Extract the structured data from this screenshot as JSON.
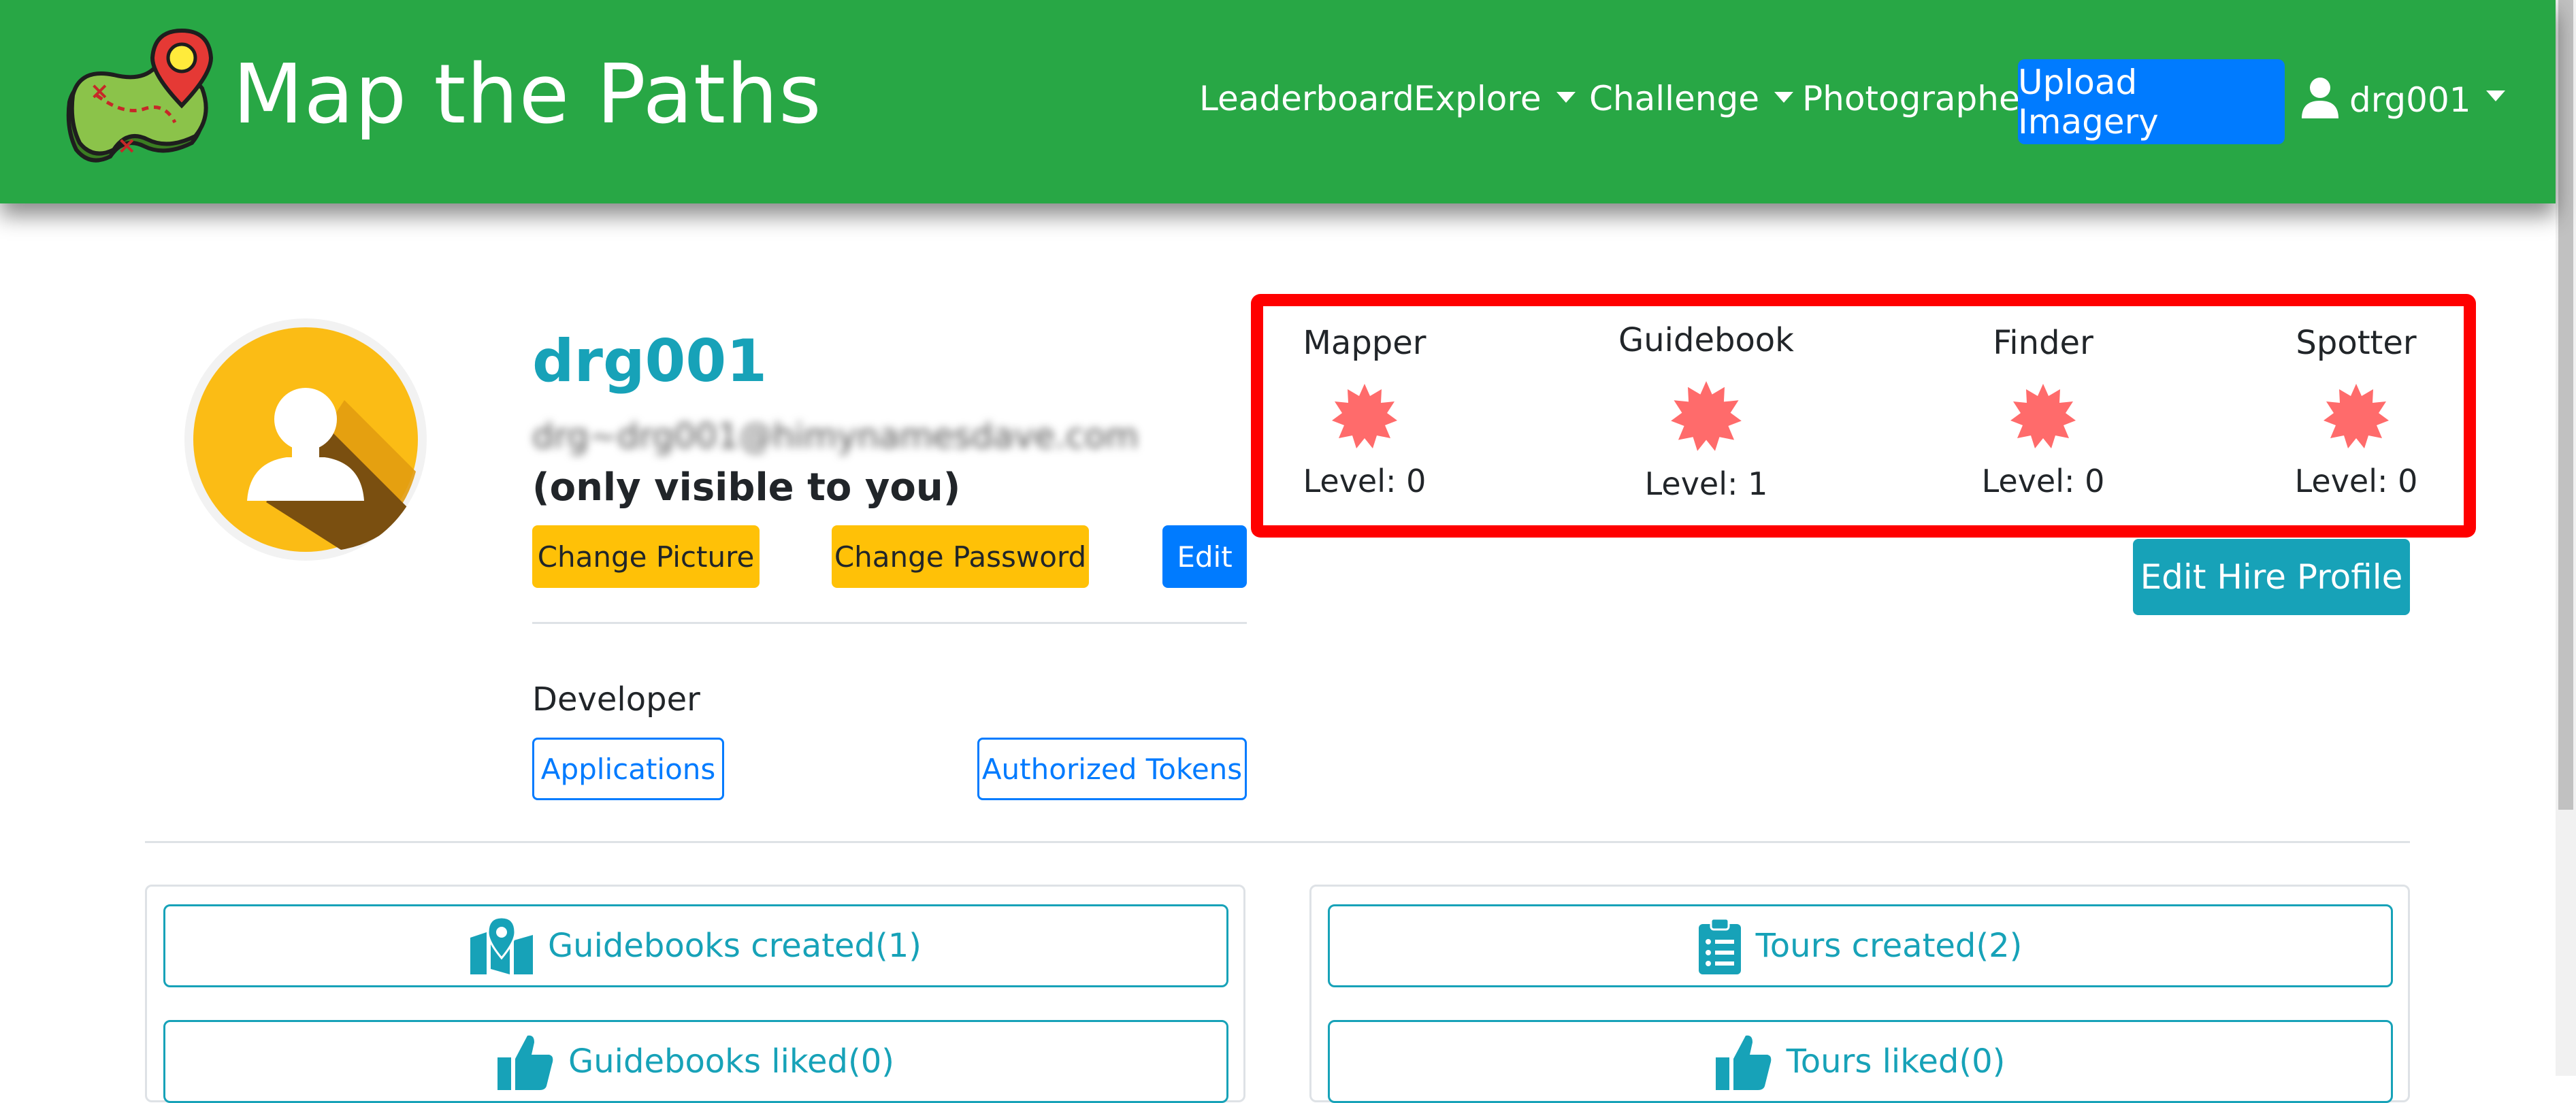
{
  "navbar": {
    "brand": "Map the Paths",
    "links": {
      "leaderboard": "Leaderboard",
      "explore": "Explore",
      "challenge": "Challenge",
      "photographer": "Photographer"
    },
    "upload_label": "Upload Imagery",
    "user_label": "drg001",
    "bg_color": "#28a745"
  },
  "profile": {
    "username": "drg001",
    "email_blurred": "drg~drg001@himynamesdave.com",
    "visibility_note": "(only visible to you)",
    "buttons": {
      "change_picture": "Change Picture",
      "change_password": "Change Password",
      "edit": "Edit"
    },
    "developer_heading": "Developer",
    "developer_buttons": {
      "applications": "Applications",
      "authorized_tokens": "Authorized Tokens"
    }
  },
  "badges": [
    {
      "title": "Mapper",
      "level": "Level: 0"
    },
    {
      "title": "Guidebook",
      "level": "Level: 1"
    },
    {
      "title": "Finder",
      "level": "Level: 0"
    },
    {
      "title": "Spotter",
      "level": "Level: 0"
    }
  ],
  "hire_profile_label": "Edit Hire Profile",
  "cards": {
    "guidebooks_created": "Guidebooks created(1)",
    "guidebooks_liked": "Guidebooks liked(0)",
    "tours_created": "Tours created(2)",
    "tours_liked": "Tours liked(0)"
  },
  "colors": {
    "accent_info": "#17a2b8",
    "primary": "#007bff",
    "warning": "#ffc107",
    "highlight_border": "#ff0000",
    "badge_star": "#ff6b6b"
  }
}
